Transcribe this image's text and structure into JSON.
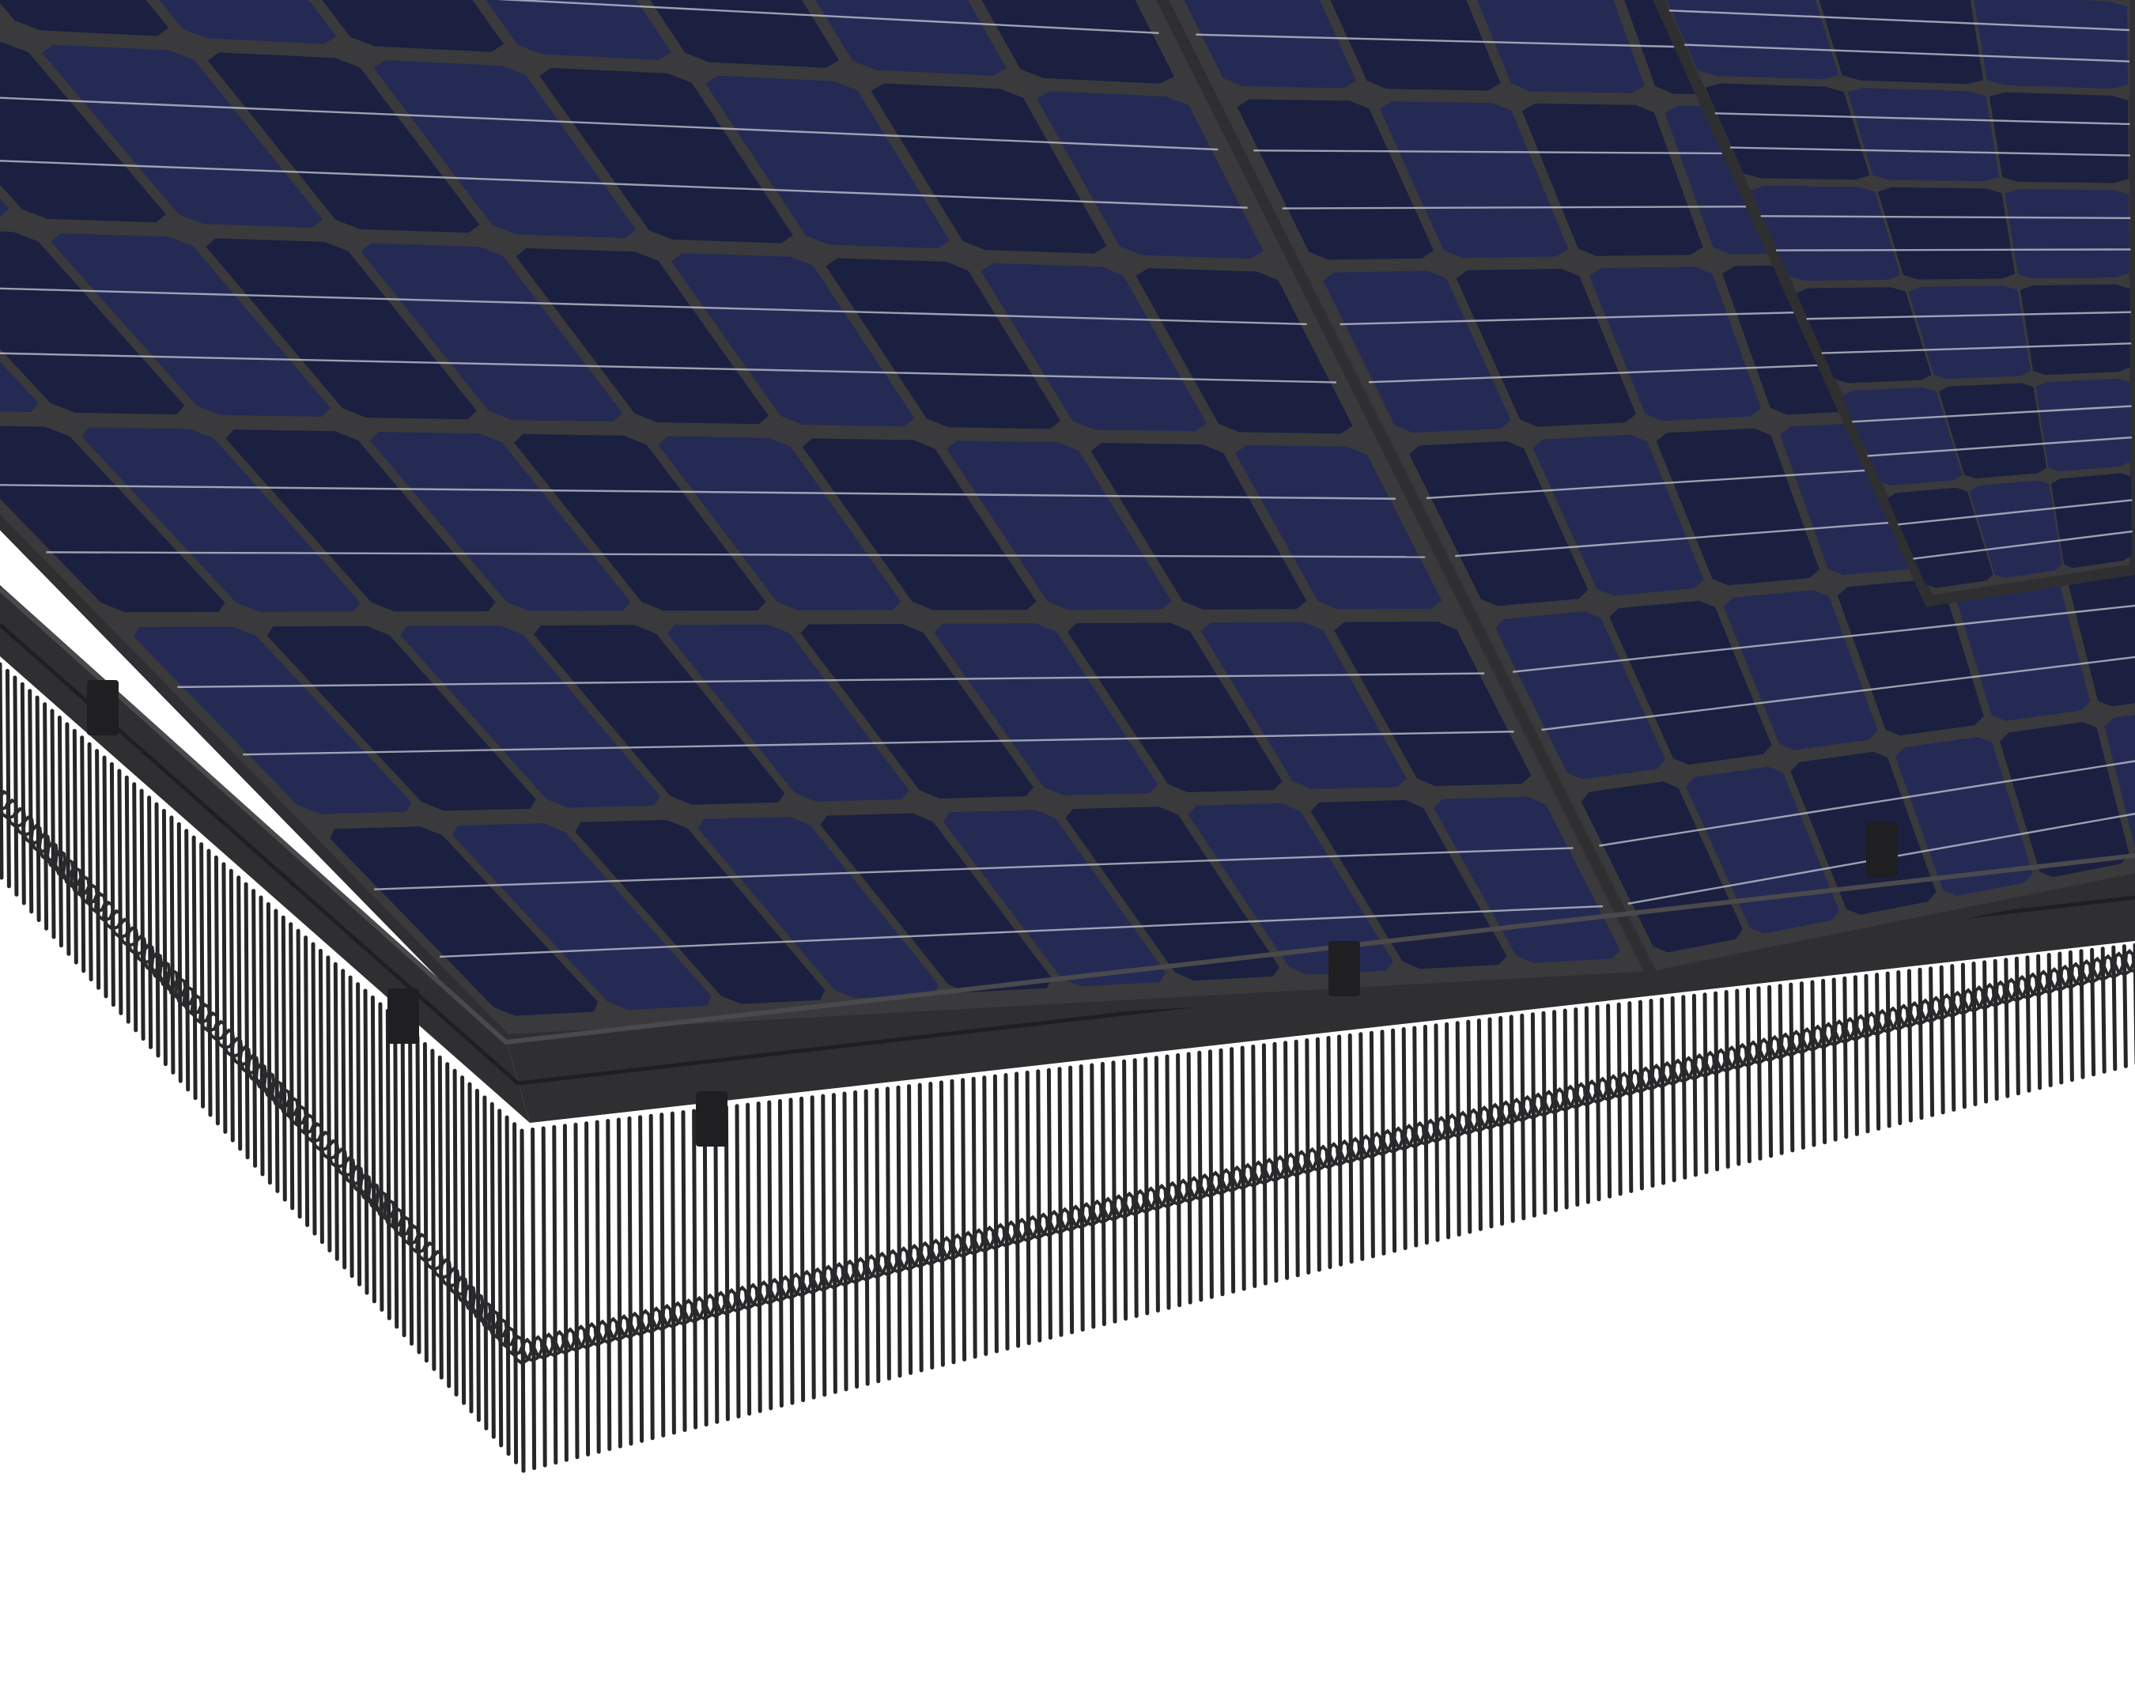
{
  "scene": {
    "subject": "solar-panel-array-with-bird-spike-guard",
    "background_color": "#ffffff",
    "panels": [
      {
        "id": "left-panel",
        "visible_cell_rows": 6,
        "visible_cell_columns": 10
      },
      {
        "id": "middle-panel",
        "visible_cell_rows": 6,
        "visible_cell_columns": 9
      },
      {
        "id": "right-panel",
        "visible_cell_rows": 6,
        "visible_cell_columns": 3
      }
    ],
    "colors": {
      "cell": "#252a55",
      "cell_shadow": "#1b1f40",
      "gap": "#3a3a3c",
      "busbar": "#c9cbd6",
      "frame": "#2f2f31",
      "frame_dark": "#1f1f21",
      "spike": "#262628",
      "coil": "#2a2a2c"
    }
  }
}
